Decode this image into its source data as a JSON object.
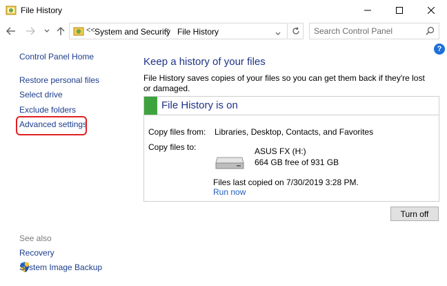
{
  "window": {
    "title": "File History"
  },
  "address": {
    "overflow": "<<",
    "crumbs": [
      "System and Security",
      "File History"
    ],
    "separator": ">"
  },
  "search": {
    "placeholder": "Search Control Panel"
  },
  "sidebar": {
    "home": "Control Panel Home",
    "items": [
      "Restore personal files",
      "Select drive",
      "Exclude folders",
      "Advanced settings"
    ],
    "see_also_label": "See also",
    "see_also": [
      "Recovery",
      "System Image Backup"
    ]
  },
  "main": {
    "heading": "Keep a history of your files",
    "description": "File History saves copies of your files so you can get them back if they're lost or damaged.",
    "status": {
      "title": "File History is on",
      "color": "#3ea33e",
      "copy_from_label": "Copy files from:",
      "copy_from_value": "Libraries, Desktop, Contacts, and Favorites",
      "copy_to_label": "Copy files to:",
      "drive_name": "ASUS FX (H:)",
      "drive_space": "664 GB free of 931 GB",
      "last_copied": "Files last copied on 7/30/2019 3:28 PM.",
      "run_now": "Run now"
    },
    "turn_off": "Turn off"
  },
  "colors": {
    "link": "#1b3d8c",
    "heading": "#1e3287",
    "highlight": "#e02020"
  }
}
